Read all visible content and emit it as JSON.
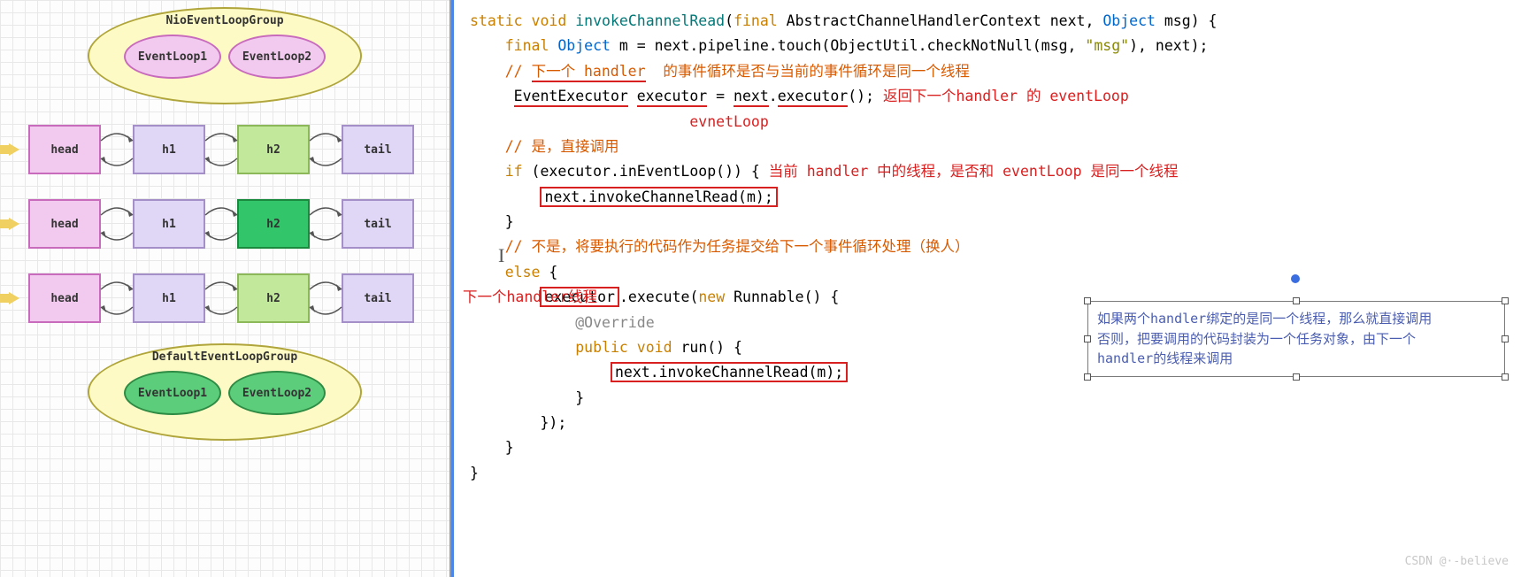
{
  "diagram": {
    "topGroup": {
      "title": "NioEventLoopGroup",
      "loop1": "EventLoop1",
      "loop2": "EventLoop2"
    },
    "bottomGroup": {
      "title": "DefaultEventLoopGroup",
      "loop1": "EventLoop1",
      "loop2": "EventLoop2"
    },
    "pipelines": [
      {
        "nodes": [
          "head",
          "h1",
          "h2",
          "tail"
        ],
        "styles": [
          "n-pink",
          "n-purple",
          "n-lime",
          "n-purple"
        ]
      },
      {
        "nodes": [
          "head",
          "h1",
          "h2",
          "tail"
        ],
        "styles": [
          "n-pink",
          "n-purple",
          "n-green",
          "n-purple"
        ]
      },
      {
        "nodes": [
          "head",
          "h1",
          "h2",
          "tail"
        ],
        "styles": [
          "n-pink",
          "n-purple",
          "n-lime",
          "n-purple"
        ]
      }
    ]
  },
  "code": {
    "l1_static": "static",
    "l1_void": "void",
    "l1_method": "invokeChannelRead",
    "l1_final": "final",
    "l1_type1": "AbstractChannelHandlerContext",
    "l1_p1": "next",
    "l1_type2": "Object",
    "l1_p2": "msg",
    "l2_final": "final",
    "l2_Object": "Object",
    "l2_rest": " m = next.pipeline.touch(ObjectUtil.checkNotNull(msg, ",
    "l2_str": "\"msg\"",
    "l2_end": "), next);",
    "c1": "// 下一个 handler  的事件循环是否与当前的事件循环是同一个线程",
    "l4_a": "EventExecutor",
    "l4_b": "executor",
    "l4_eq": " = ",
    "l4_c": "next",
    "l4_dot": ".",
    "l4_d": "executor",
    "l4_paren": "();",
    "l4_note": "返回下一个handler 的 eventLoop",
    "l4_sub": "evnetLoop",
    "c2": "// 是，直接调用",
    "l6_a": "if",
    "l6_b": " (executor.inEventLoop()) {",
    "l6_note": "当前 handler 中的线程，是否和 eventLoop 是同一个线程",
    "l7_box": "next.invokeChannelRead(m);",
    "l8": "}",
    "c3": "// 不是，将要执行的代码作为任务提交给下一个事件循环处理（换人）",
    "l10_a": "else",
    " l10_b": " {",
    "l11_box": "executor",
    "l11_rest": ".execute(",
    "l11_new": "new",
    "l11_Runnable": " Runnable() {",
    "l11_left": "下一个handler线程",
    "l12_at": "@Override",
    "l13_pub": "public",
    "l13_void": "void",
    "l13_run": " run() {",
    "l14_box": "next.invokeChannelRead(m);",
    "l15": "}",
    "l16": "});",
    "l17": "}",
    "l18": "}"
  },
  "callout": {
    "line1": "如果两个handler绑定的是同一个线程，那么就直接调用",
    "line2": "否则，把要调用的代码封装为一个任务对象，由下一个",
    "line3": "handler的线程来调用"
  },
  "watermark": "CSDN @·-believe"
}
